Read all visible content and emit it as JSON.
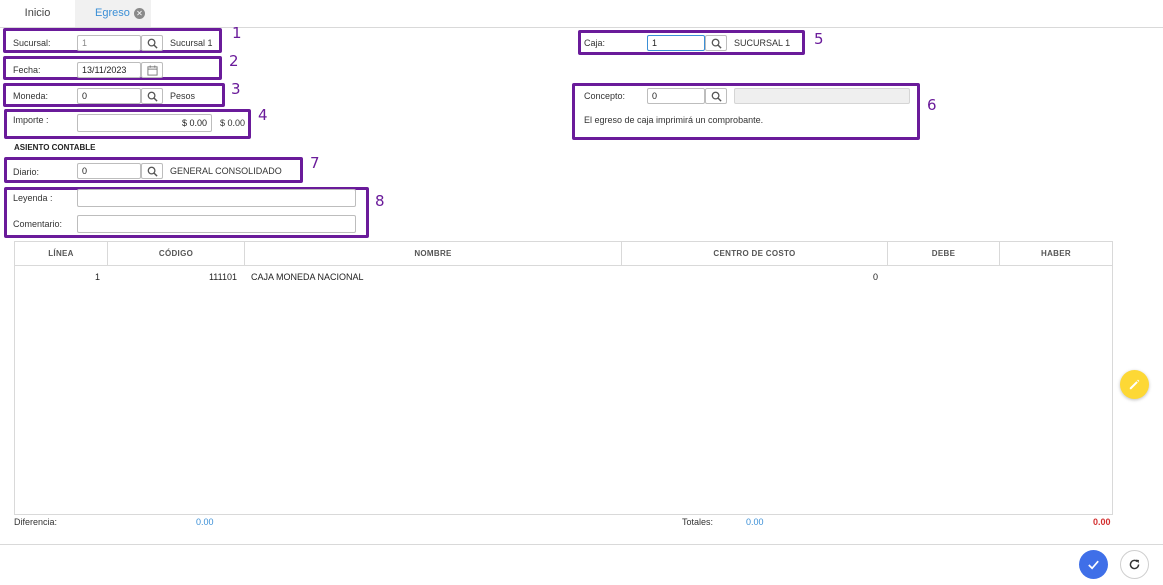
{
  "tabs": [
    {
      "label": "Inicio"
    },
    {
      "label": "Egreso",
      "close_icon": "close-icon"
    }
  ],
  "form": {
    "sucursal": {
      "label": "Sucursal:",
      "value": "1",
      "desc": "Sucursal 1"
    },
    "fecha": {
      "label": "Fecha:",
      "value": "13/11/2023"
    },
    "moneda": {
      "label": "Moneda:",
      "value": "0",
      "desc": "Pesos"
    },
    "importe": {
      "label": "Importe :",
      "value": "$ 0.00",
      "desc": "$ 0.00"
    },
    "asiento_title": "ASIENTO CONTABLE",
    "diario": {
      "label": "Diario:",
      "value": "0",
      "desc": "GENERAL CONSOLIDADO"
    },
    "leyenda": {
      "label": "Leyenda :",
      "value": ""
    },
    "comentario": {
      "label": "Comentario:",
      "value": ""
    },
    "caja": {
      "label": "Caja:",
      "value": "1",
      "desc": "SUCURSAL 1"
    },
    "concepto": {
      "label": "Concepto:",
      "value": "0",
      "desc": "",
      "note": "El egreso de caja imprimirá un comprobante."
    }
  },
  "annotations": [
    "1",
    "2",
    "3",
    "4",
    "5",
    "6",
    "7",
    "8"
  ],
  "grid": {
    "columns": [
      "LÍNEA",
      "CÓDIGO",
      "NOMBRE",
      "CENTRO DE COSTO",
      "DEBE",
      "HABER"
    ],
    "rows": [
      {
        "linea": "1",
        "codigo": "111101",
        "nombre": "CAJA MONEDA NACIONAL",
        "centro": "0",
        "debe": "",
        "haber": ""
      }
    ]
  },
  "footer": {
    "diferencia_label": "Diferencia:",
    "diferencia_value": "0.00",
    "totales_label": "Totales:",
    "totales_debe": "0.00",
    "totales_haber": "0.00"
  },
  "colors": {
    "accent": "#3b8fd6",
    "highlight": "#6a1b9a",
    "edit_fab": "#fdd835",
    "confirm": "#3f6fe8",
    "negative": "#d32f2f"
  },
  "icons": [
    "search-icon",
    "calendar-icon",
    "pencil-icon",
    "check-icon",
    "refresh-icon",
    "close-icon"
  ]
}
